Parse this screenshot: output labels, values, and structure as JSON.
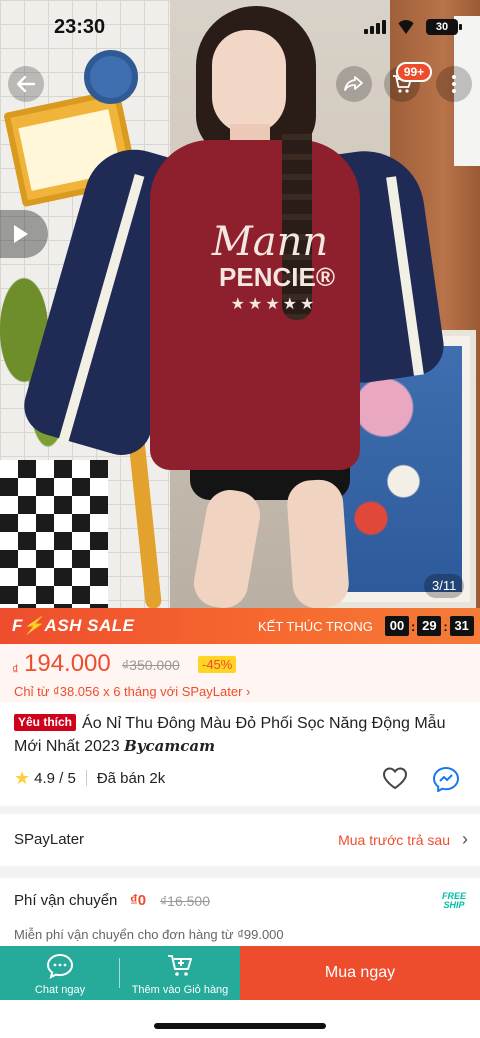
{
  "status_bar": {
    "time": "23:30",
    "battery": "30"
  },
  "nav": {
    "cart_badge": "99+",
    "back_icon": "arrow-left-icon",
    "share_icon": "share-icon",
    "cart_icon": "cart-icon",
    "more_icon": "more-dots-icon"
  },
  "media": {
    "counter": "3/11",
    "video_icon": "play-icon"
  },
  "flash_sale": {
    "title": "F⚡ASH SALE",
    "ends_label": "KẾT THÚC TRONG",
    "hours": "00",
    "minutes": "29",
    "seconds": "31"
  },
  "price": {
    "currency": "₫",
    "current": "194.000",
    "original": "₫350.000",
    "discount": "-45%",
    "installment": "Chỉ từ ₫38.056 x 6 tháng với SPayLater ›"
  },
  "product": {
    "badge": "Yêu thích",
    "title": "Áo Nỉ Thu Đông Màu Đỏ Phối Sọc Năng Động Mẫu Mới Nhất 2023",
    "brand": "Bycamcam",
    "rating": "4.9 / 5",
    "sold": "Đã bán 2k"
  },
  "spaylater": {
    "label": "SPayLater",
    "cta": "Mua trước trả sau",
    "chevron": "›"
  },
  "shipping": {
    "label": "Phí vận chuyển",
    "price": "₫0",
    "original": "₫16.500",
    "badge_line1": "FREE",
    "badge_line2": "SHIP",
    "note": "Miễn phí vận chuyển cho đơn hàng từ ₫99.000"
  },
  "actions": {
    "chat": "Chat ngay",
    "add_cart": "Thêm vào Giỏ hàng",
    "buy": "Mua ngay"
  },
  "colors": {
    "brand": "#ee4d2d",
    "teal": "#26aa99",
    "star": "#ffce3d"
  },
  "photo": {
    "print_main": "Mann",
    "print_sub": "PENCIE®",
    "print_stars": "★★★★★"
  }
}
